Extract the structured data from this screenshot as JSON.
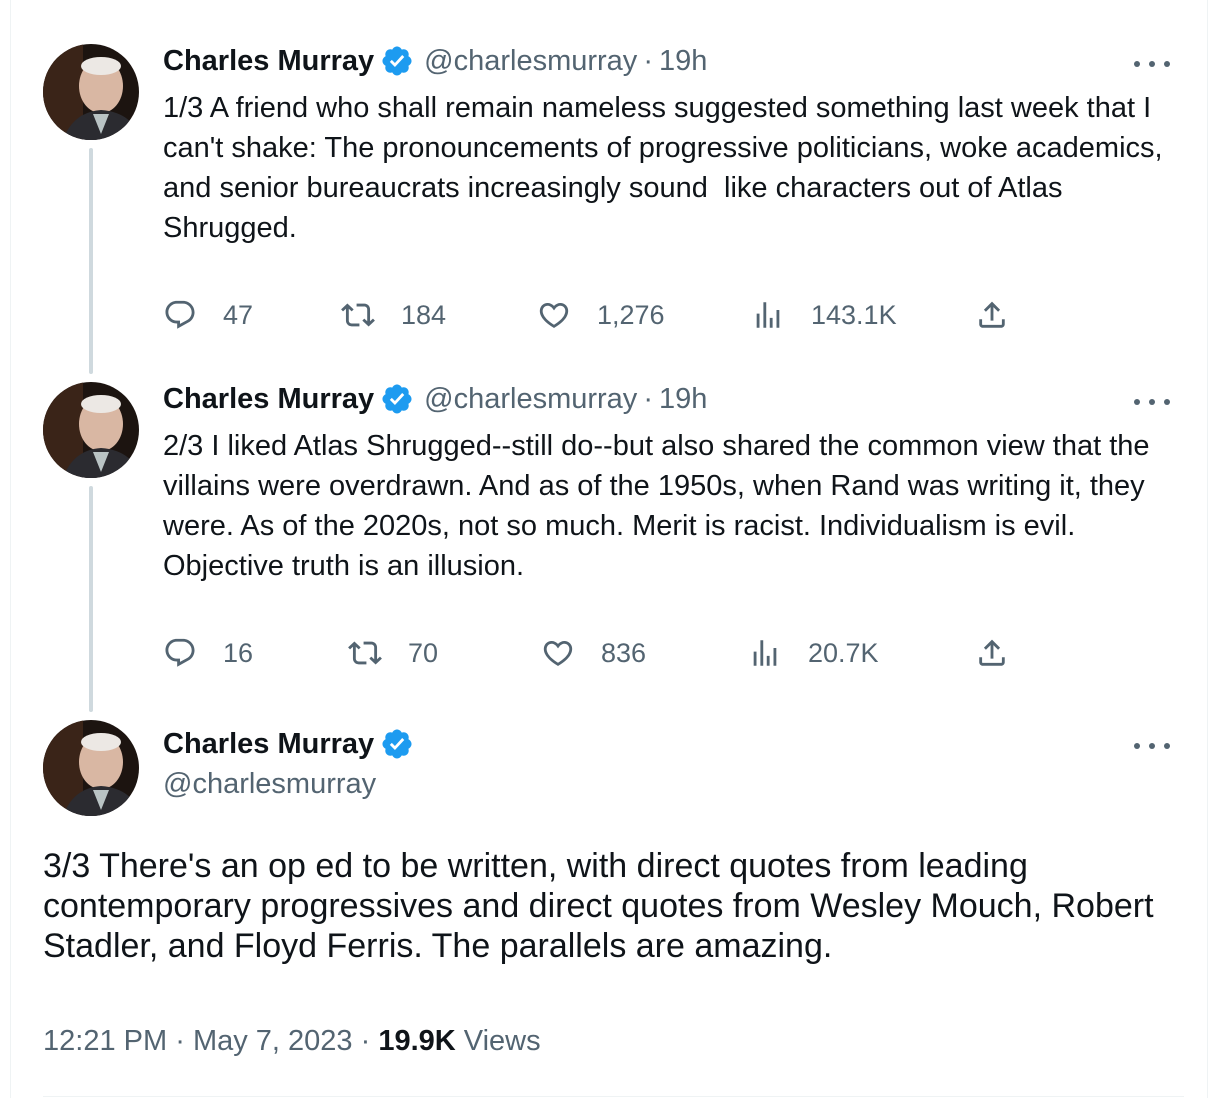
{
  "colors": {
    "text": "#0f1419",
    "secondary": "#536471",
    "verified": "#1d9bf0",
    "thread_line": "#cfd9de"
  },
  "tweets": [
    {
      "author_name": "Charles Murray",
      "handle": "@charlesmurray",
      "separator": "·",
      "time": "19h",
      "text": "1/3 A friend who shall remain nameless suggested something last week that I can't shake: The pronouncements of progressive politicians, woke academics, and senior bureaucrats increasingly sound  like characters out of Atlas Shrugged.",
      "replies": "47",
      "retweets": "184",
      "likes": "1,276",
      "views": "143.1K"
    },
    {
      "author_name": "Charles Murray",
      "handle": "@charlesmurray",
      "separator": "·",
      "time": "19h",
      "text": "2/3 I liked Atlas Shrugged--still do--but also shared the common view that the villains were overdrawn. And as of the 1950s, when Rand was writing it, they were. As of the 2020s, not so much. Merit is racist. Individualism is evil. Objective truth is an illusion.",
      "replies": "16",
      "retweets": "70",
      "likes": "836",
      "views": "20.7K"
    }
  ],
  "main_tweet": {
    "author_name": "Charles Murray",
    "handle": "@charlesmurray",
    "text": "3/3 There's an op ed to be written, with direct quotes from leading contemporary progressives and direct quotes from Wesley Mouch, Robert Stadler, and Floyd Ferris. The parallels are amazing.",
    "time": "12:21 PM",
    "separator": "·",
    "date": "May 7, 2023",
    "views_count": "19.9K",
    "views_label": "Views"
  },
  "icons": {
    "verified": "verified-badge-icon",
    "reply": "reply-icon",
    "retweet": "retweet-icon",
    "like": "heart-icon",
    "views": "views-icon",
    "share": "share-icon",
    "more": "more-icon"
  }
}
